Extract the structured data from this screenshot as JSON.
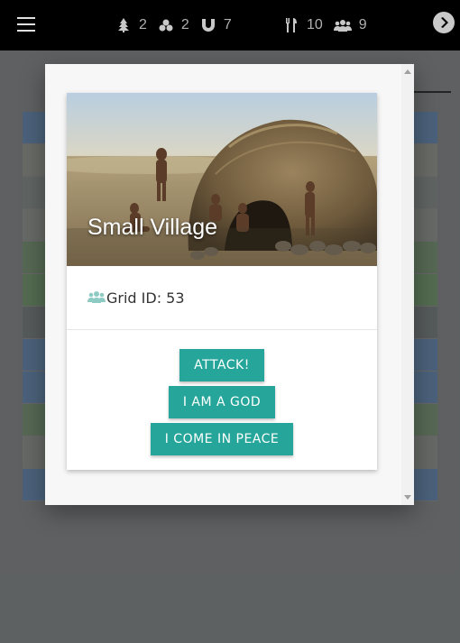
{
  "topbar": {
    "stats": [
      {
        "icon": "tree-icon",
        "value": "2"
      },
      {
        "icon": "stones-icon",
        "value": "2"
      },
      {
        "icon": "magnet-icon",
        "value": "7"
      },
      {
        "icon": "fork-knife-icon",
        "value": "10"
      },
      {
        "icon": "people-icon",
        "value": "9"
      }
    ]
  },
  "modal": {
    "card": {
      "title": "Small Village",
      "grid_label": "Grid ID: 53",
      "actions": [
        "ATTACK!",
        "I AM A GOD",
        "I COME IN PEACE"
      ]
    }
  },
  "colors": {
    "accent": "#26a69a",
    "topbar": "#000000",
    "overlay": "#7b7f80"
  }
}
